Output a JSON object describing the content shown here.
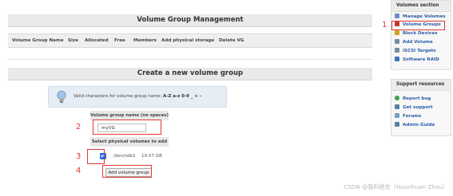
{
  "vg_management": {
    "title": "Volume Group Management",
    "columns": [
      "Volume Group Name",
      "Size",
      "Allocated",
      "Free",
      "Members",
      "Add physical storage",
      "Delete VG"
    ]
  },
  "create_vg": {
    "title": "Create a new volume group",
    "info_prefix": "Valid characters for volume group name:",
    "info_chars": "A-Z a-z 0-9 _ + -",
    "name_label": "Volume group name (no spaces)",
    "name_value": "myVG",
    "pv_label": "Select physical volumes to add",
    "pv_rows": [
      {
        "device": "/dev/sdb1",
        "size": "19.07 GB",
        "checked": true
      }
    ],
    "submit_label": "Add volume group"
  },
  "annotations": {
    "markers": [
      "1",
      "2",
      "3",
      "4"
    ],
    "color": "#e53935"
  },
  "sidebar": {
    "volumes": {
      "title": "Volumes section",
      "items": [
        {
          "label": "Manage Volumes",
          "icon": "volumes-icon",
          "color": "#6b8fc2"
        },
        {
          "label": "Volume Groups",
          "icon": "volume-groups-icon",
          "color": "#c0392b"
        },
        {
          "label": "Block Devices",
          "icon": "block-devices-icon",
          "color": "#d4a017"
        },
        {
          "label": "Add Volume",
          "icon": "add-volume-icon",
          "color": "#7a8c9e"
        },
        {
          "label": "iSCSI Targets",
          "icon": "iscsi-icon",
          "color": "#7a8c9e"
        },
        {
          "label": "Software RAID",
          "icon": "raid-icon",
          "color": "#3b78c4"
        }
      ]
    },
    "support": {
      "title": "Support resources",
      "items": [
        {
          "label": "Report bug",
          "icon": "bug-icon",
          "color": "#3aa34a"
        },
        {
          "label": "Get support",
          "icon": "support-icon",
          "color": "#5b7fa8"
        },
        {
          "label": "Forums",
          "icon": "forums-icon",
          "color": "#7a9cc4"
        },
        {
          "label": "Admin Guide",
          "icon": "guide-icon",
          "color": "#5b7fa8"
        }
      ]
    }
  },
  "watermark": "CSDN @我科绝伦（Huanhuan Zhou）"
}
